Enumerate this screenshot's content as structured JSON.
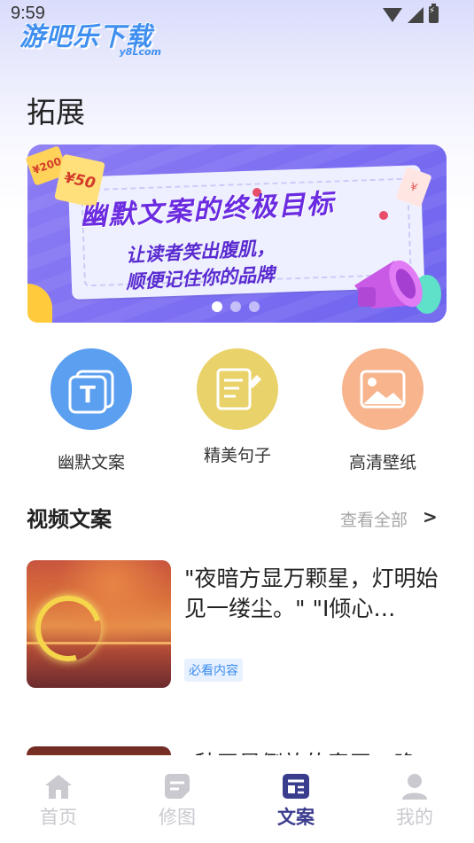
{
  "status_bar": {
    "time": "9:59"
  },
  "watermark": {
    "main": "游吧乐下载",
    "sub": "y8Lcom"
  },
  "page": {
    "title": "拓展"
  },
  "banner": {
    "headline": "幽默文案的终极目标",
    "line1": "让读者笑出腹肌，",
    "line2": "顺便记住你的品牌",
    "coupon_small": "¥200",
    "coupon_large": "¥50",
    "ticket": "¥",
    "dots_count": 3,
    "active_dot": 0
  },
  "quick_links": [
    {
      "label": "幽默文案",
      "icon": "text-t-icon",
      "color": "#5b9ff0"
    },
    {
      "label": "精美句子",
      "icon": "notepad-pen-icon",
      "color": "#e9d26a"
    },
    {
      "label": "高清壁纸",
      "icon": "image-icon",
      "color": "#f7b48d"
    }
  ],
  "section": {
    "title": "视频文案",
    "view_all": "查看全部",
    "arrow": ">"
  },
  "articles": [
    {
      "title": "\"夜暗方显万颗星，灯明始见一缕尘。\" \"I倾心…",
      "tag": "必看内容"
    },
    {
      "title": "\"秋天是倒放的春天，晚"
    }
  ],
  "bottom_nav": [
    {
      "label": "首页",
      "icon": "home-icon",
      "active": false
    },
    {
      "label": "修图",
      "icon": "edit-image-icon",
      "active": false
    },
    {
      "label": "文案",
      "icon": "article-icon",
      "active": true
    },
    {
      "label": "我的",
      "icon": "profile-icon",
      "active": false
    }
  ],
  "colors": {
    "accent": "#3a3c8e",
    "inactive_nav": "#c9c9cf",
    "tag_text": "#3c8cf0",
    "tag_bg": "#e8f1ff"
  }
}
